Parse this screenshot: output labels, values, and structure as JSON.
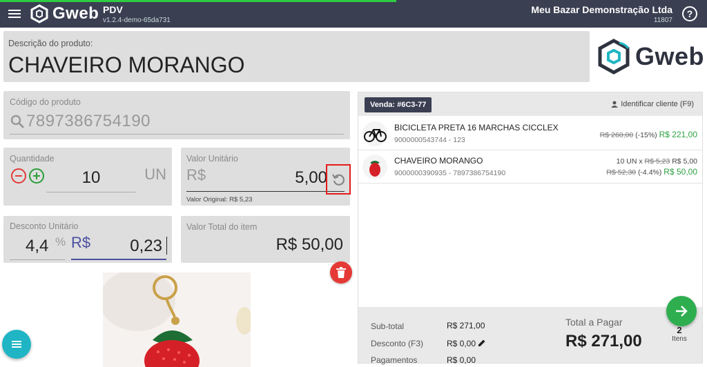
{
  "topbar": {
    "brand": "Gweb",
    "app_title": "PDV",
    "version": "v1.2.4-demo-65da731",
    "company_name": "Meu Bazar Demonstração Ltda",
    "company_code": "11807",
    "help_symbol": "?"
  },
  "product": {
    "description_label": "Descrição do produto:",
    "description": "CHAVEIRO MORANGO",
    "code_label": "Código do produto",
    "code": "7897386754190"
  },
  "logo_right": {
    "brand": "Gweb"
  },
  "quantity": {
    "label": "Quantidade",
    "value": "10",
    "unit": "UN"
  },
  "unit_value": {
    "label": "Valor Unitário",
    "currency": "R$",
    "value": "5,00",
    "original": "Valor Original: R$ 5,23"
  },
  "discount": {
    "label": "Desconto Unitário",
    "percent": "4,4",
    "percent_symbol": "%",
    "currency": "R$",
    "value": "0,23"
  },
  "item_total": {
    "label": "Valor Total do item",
    "value": "R$ 50,00"
  },
  "sale": {
    "badge": "Venda: #6C3-77",
    "identify_client": "Identificar cliente (F9)",
    "items": [
      {
        "name": "BICICLETA PRETA 16 MARCHAS CICCLEX",
        "code": "9000000543744 - 123",
        "line1": "",
        "orig_price": "R$ 260,00",
        "discount_pct": "(-15%)",
        "final_price": "R$ 221,00"
      },
      {
        "name": "CHAVEIRO MORANGO",
        "code": "9000000390935 - 7897386754190",
        "line1_qty": "10 UN x",
        "line1_orig": "R$ 5,23",
        "line1_unit": "R$ 5,00",
        "orig_price": "R$ 52,30",
        "discount_pct": "(-4.4%)",
        "final_price": "R$ 50,00"
      }
    ],
    "footer": {
      "subtotal_label": "Sub-total",
      "subtotal_value": "R$ 271,00",
      "discount_label": "Desconto (F3)",
      "discount_value": "R$ 0,00",
      "payments_label": "Pagamentos",
      "payments_value": "R$ 0,00",
      "to_pay_label": "Total a Pagar",
      "to_pay_value": "R$ 271,00",
      "items_count": "2",
      "items_label": "Itens"
    }
  },
  "colors": {
    "topbar": "#3a3f52",
    "panel": "#dedede",
    "accent_green": "#2eae4f",
    "delete_red": "#e53935",
    "menu_teal": "#1fb5c4",
    "annotation_red": "#e41b1b"
  },
  "icons": [
    "hamburger-icon",
    "gweb-logo-icon",
    "help-icon",
    "search-icon",
    "minus-icon",
    "plus-icon",
    "reset-icon",
    "trash-icon",
    "person-icon",
    "pencil-icon",
    "arrow-right-icon",
    "menu-icon"
  ]
}
